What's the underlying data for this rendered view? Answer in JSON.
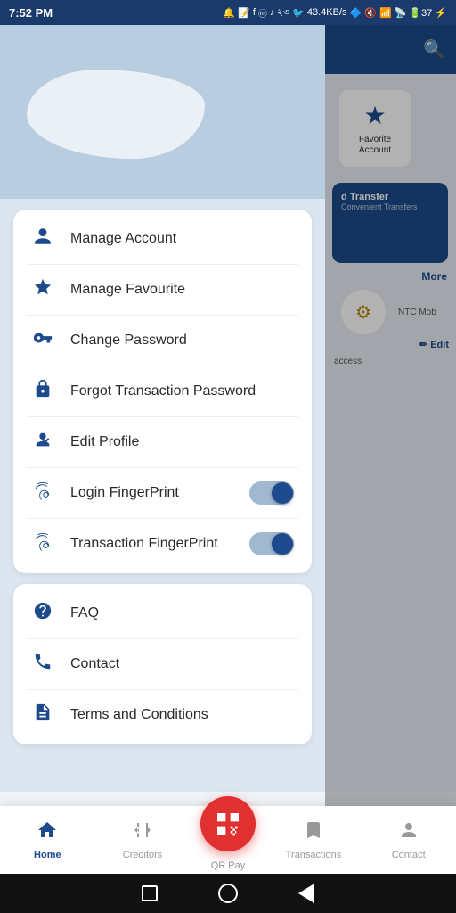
{
  "statusBar": {
    "time": "7:52 PM",
    "network": "43.4KB/s",
    "battery": "37"
  },
  "drawer": {
    "menu": {
      "items": [
        {
          "id": "manage-account",
          "label": "Manage Account",
          "icon": "person"
        },
        {
          "id": "manage-favourite",
          "label": "Manage Favourite",
          "icon": "star"
        },
        {
          "id": "change-password",
          "label": "Change Password",
          "icon": "key"
        },
        {
          "id": "forgot-transaction-password",
          "label": "Forgot Transaction Password",
          "icon": "lock"
        },
        {
          "id": "edit-profile",
          "label": "Edit Profile",
          "icon": "person-edit"
        },
        {
          "id": "login-fingerprint",
          "label": "Login FingerPrint",
          "icon": "fingerprint",
          "toggle": true,
          "toggleOn": true
        },
        {
          "id": "transaction-fingerprint",
          "label": "Transaction FingerPrint",
          "icon": "fingerprint",
          "toggle": true,
          "toggleOn": true
        }
      ]
    },
    "support": {
      "items": [
        {
          "id": "faq",
          "label": "FAQ",
          "icon": "question"
        },
        {
          "id": "contact",
          "label": "Contact",
          "icon": "phone"
        },
        {
          "id": "terms",
          "label": "Terms and Conditions",
          "icon": "document"
        }
      ]
    }
  },
  "rightApp": {
    "favoriteAccount": "Favorite Account",
    "transfer": "d Transfer",
    "transferSub": "Convenient Transfers",
    "more": "More",
    "ntcMob": "NTC Mob",
    "edit": "Edit",
    "access": "access"
  },
  "bottomNav": {
    "items": [
      {
        "id": "home",
        "label": "Home",
        "icon": "home",
        "active": true
      },
      {
        "id": "creditors",
        "label": "Creditors",
        "icon": "transfer",
        "active": false
      },
      {
        "id": "qrpay",
        "label": "QR Pay",
        "icon": "qr",
        "active": false,
        "fab": true
      },
      {
        "id": "transactions",
        "label": "Transactions",
        "icon": "bookmark",
        "active": false
      },
      {
        "id": "contact",
        "label": "Contact",
        "icon": "contact",
        "active": false
      }
    ]
  }
}
